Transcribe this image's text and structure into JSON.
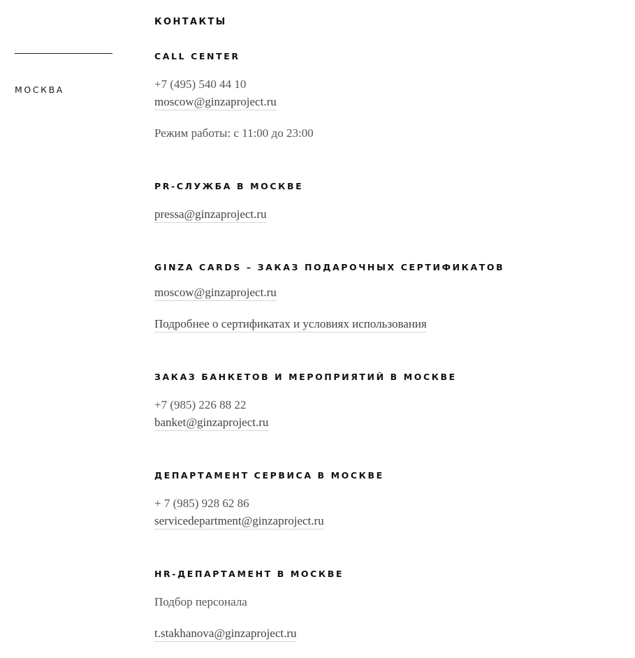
{
  "sidebar": {
    "city": "МОСКВА"
  },
  "main": {
    "title": "КОНТАКТЫ",
    "call_center": {
      "title": "CALL CENTER",
      "phone": "+7 (495) 540 44 10",
      "email": "moscow@ginzaproject.ru",
      "hours": "Режим работы: с 11:00 до 23:00"
    },
    "pr": {
      "title": "PR-СЛУЖБА В МОСКВЕ",
      "email": "pressa@ginzaproject.ru"
    },
    "cards": {
      "title": "GINZA CARDS – ЗАКАЗ ПОДАРОЧНЫХ СЕРТИФИКАТОВ",
      "email": "moscow@ginzaproject.ru",
      "details_link": "Подробнее о сертификатах и условиях использования"
    },
    "banquets": {
      "title": "ЗАКАЗ БАНКЕТОВ И МЕРОПРИЯТИЙ В МОСКВЕ",
      "phone": "+7 (985) 226 88 22",
      "email": "banket@ginzaproject.ru"
    },
    "service": {
      "title": "ДЕПАРТАМЕНТ СЕРВИСА В МОСКВЕ",
      "phone": "+ 7 (985) 928 62 86",
      "email": "servicedepartment@ginzaproject.ru"
    },
    "hr": {
      "title": "HR-ДЕПАРТАМЕНТ В МОСКВЕ",
      "subtitle": "Подбор персонала",
      "email": "t.stakhanova@ginzaproject.ru"
    }
  }
}
